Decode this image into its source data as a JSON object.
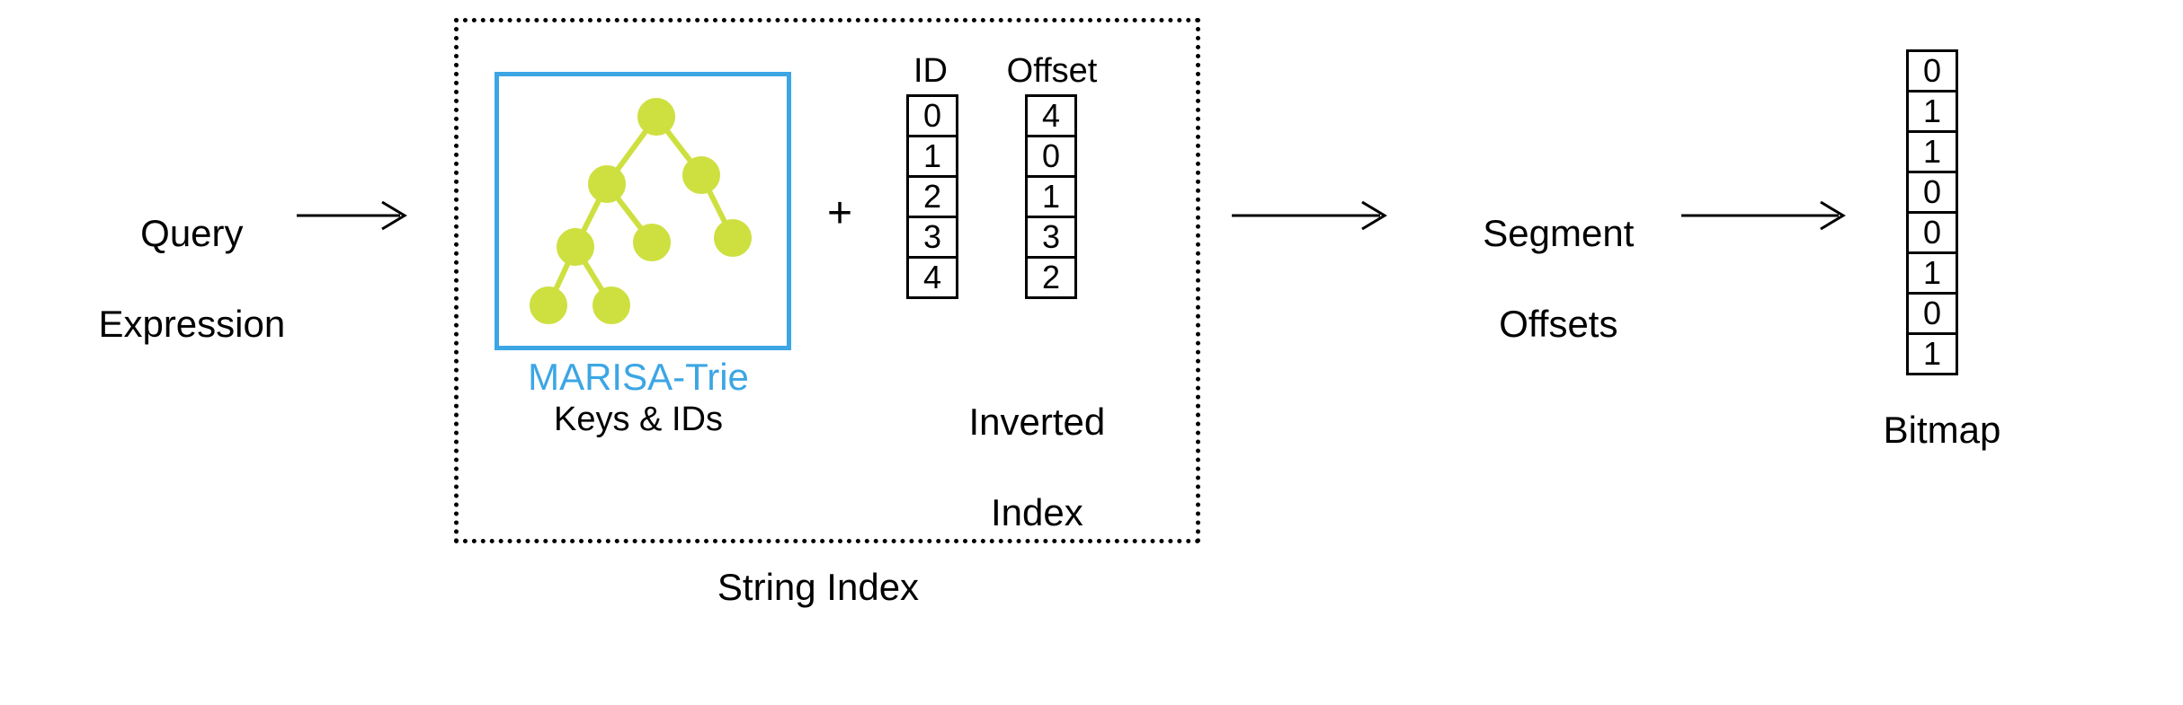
{
  "input": {
    "line1": "Query",
    "line2": "Expression"
  },
  "string_index": {
    "caption": "String Index",
    "trie": {
      "label": "MARISA-Trie",
      "sub": "Keys & IDs"
    },
    "plus": "+",
    "inverted": {
      "id_header": "ID",
      "offset_header": "Offset",
      "ids": [
        "0",
        "1",
        "2",
        "3",
        "4"
      ],
      "offsets": [
        "4",
        "0",
        "1",
        "3",
        "2"
      ],
      "caption_line1": "Inverted",
      "caption_line2": "Index"
    }
  },
  "segment_offsets": {
    "line1": "Segment",
    "line2": "Offsets"
  },
  "bitmap": {
    "values": [
      "0",
      "1",
      "1",
      "0",
      "0",
      "1",
      "0",
      "1"
    ],
    "caption": "Bitmap"
  },
  "colors": {
    "accent": "#3ca6e4",
    "node": "#cde040"
  }
}
